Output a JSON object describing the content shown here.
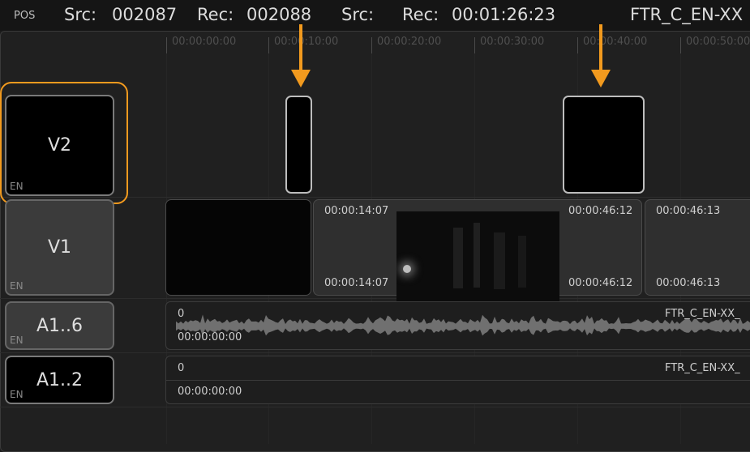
{
  "topbar": {
    "pos_label": "POS",
    "src_label": "Src:",
    "src_value": "002087",
    "rec_label": "Rec:",
    "rec_value": "002088",
    "src2_label": "Src:",
    "rec2_label": "Rec:",
    "rec2_value": "00:01:26:23",
    "clip_name": "FTR_C_EN-XX"
  },
  "ruler": {
    "labels": [
      "00:00:00:00",
      "00:00:10:00",
      "00:00:20:00",
      "00:00:30:00",
      "00:00:40:00",
      "00:00:50:00"
    ]
  },
  "tracks": {
    "v2": {
      "name": "V2",
      "lang": "EN"
    },
    "v1": {
      "name": "V1",
      "lang": "EN"
    },
    "a16": {
      "name": "A1..6",
      "lang": "EN"
    },
    "a12": {
      "name": "A1..2",
      "lang": "EN"
    }
  },
  "v1_clips": {
    "clip2_in_top": "00:00:14:07",
    "clip2_out_top": "00:00:46:12",
    "clip2_in_bottom": "00:00:14:07",
    "clip2_out_bottom": "00:00:46:12",
    "clip3_in_top": "00:00:46:13",
    "clip3_in_bottom": "00:00:46:13"
  },
  "audio": {
    "a16": {
      "level": "0",
      "timecode": "00:00:00:00",
      "name": "FTR_C_EN-XX_"
    },
    "a12": {
      "level": "0",
      "timecode": "00:00:00:00",
      "name": "FTR_C_EN-XX_"
    }
  },
  "colors": {
    "accent": "#f29a1e",
    "background": "#1b1b1b",
    "clip_border": "#bdbdbd"
  }
}
